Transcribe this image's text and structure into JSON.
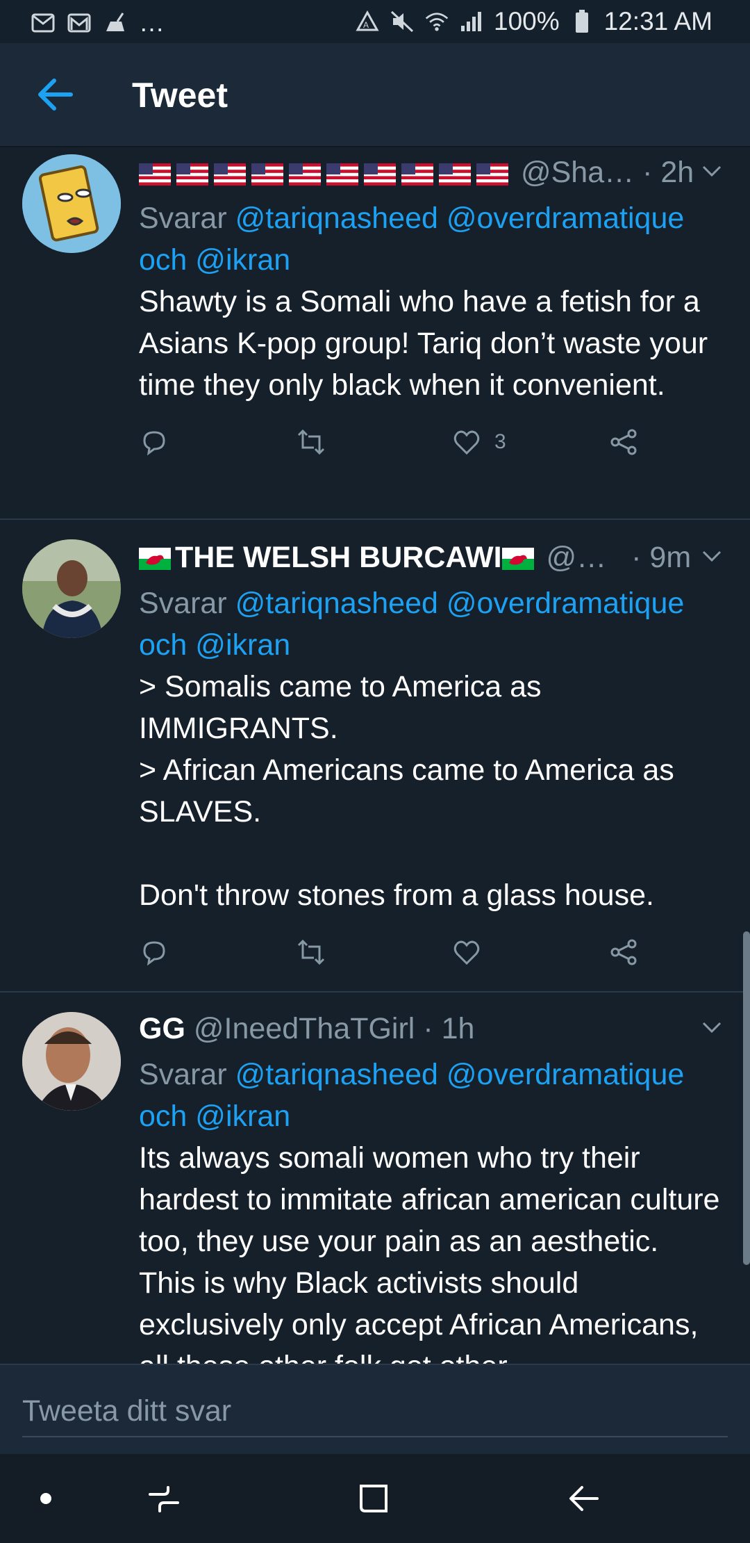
{
  "status_bar": {
    "dots": "…",
    "battery": "100%",
    "time": "12:31 AM"
  },
  "header": {
    "title": "Tweet"
  },
  "tweets": [
    {
      "name_flags": "🇺🇸🇺🇸🇺🇸🇺🇸🇺🇸🇺🇸🇺🇸🇺🇸🇺🇸🇺🇸",
      "handle": "@Sha…",
      "time": "· 2h",
      "reply_prefix": "Svarar",
      "mention1": "@tariqnasheed",
      "mention2": "@overdramatique",
      "och": "och",
      "mention3": "@ikran",
      "text": "Shawty is a Somali who have a fetish for a Asians K-pop group! Tariq don’t waste your time they only black when it convenient.",
      "likes": "3"
    },
    {
      "name": "THE WELSH BURCAWI",
      "handle": "@…",
      "time": "· 9m",
      "reply_prefix": "Svarar",
      "mention1": "@tariqnasheed",
      "mention2": "@overdramatique",
      "och": "och",
      "mention3": "@ikran",
      "text": "> Somalis came to America as IMMIGRANTS.\n> African Americans came to America as SLAVES.\n\nDon't throw stones from a glass house.",
      "likes": ""
    },
    {
      "name": "GG",
      "handle": "@IneedThaTGirl",
      "time": "· 1h",
      "reply_prefix": "Svarar",
      "mention1": "@tariqnasheed",
      "mention2": "@overdramatique",
      "och": "och",
      "mention3": "@ikran",
      "text": "Its always somali women who try their hardest to immitate african american culture too, they use your pain as an aesthetic. This is why Black activists should exclusively only accept African Americans, all these other folk got other"
    }
  ],
  "compose": {
    "placeholder": "Tweeta ditt svar"
  },
  "colors": {
    "background": "#15202b",
    "header": "#1c2938",
    "accent": "#1da1f2",
    "muted": "#8899a6"
  }
}
